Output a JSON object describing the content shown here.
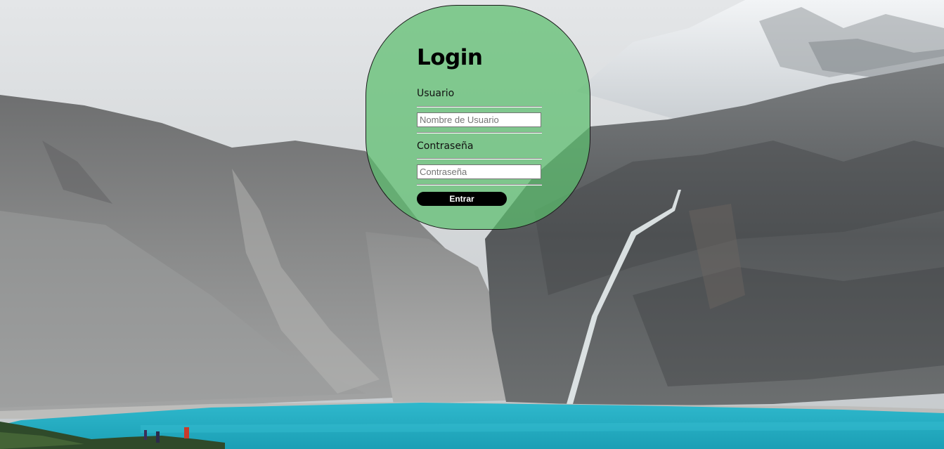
{
  "login": {
    "title": "Login",
    "username": {
      "label": "Usuario",
      "placeholder": "Nombre de Usuario"
    },
    "password": {
      "label": "Contraseña",
      "placeholder": "Contraseña"
    },
    "submit_label": "Entrar"
  },
  "colors": {
    "card_background": "#5cbe6e",
    "button_background": "#000000",
    "lake": "#2bb5c9"
  }
}
